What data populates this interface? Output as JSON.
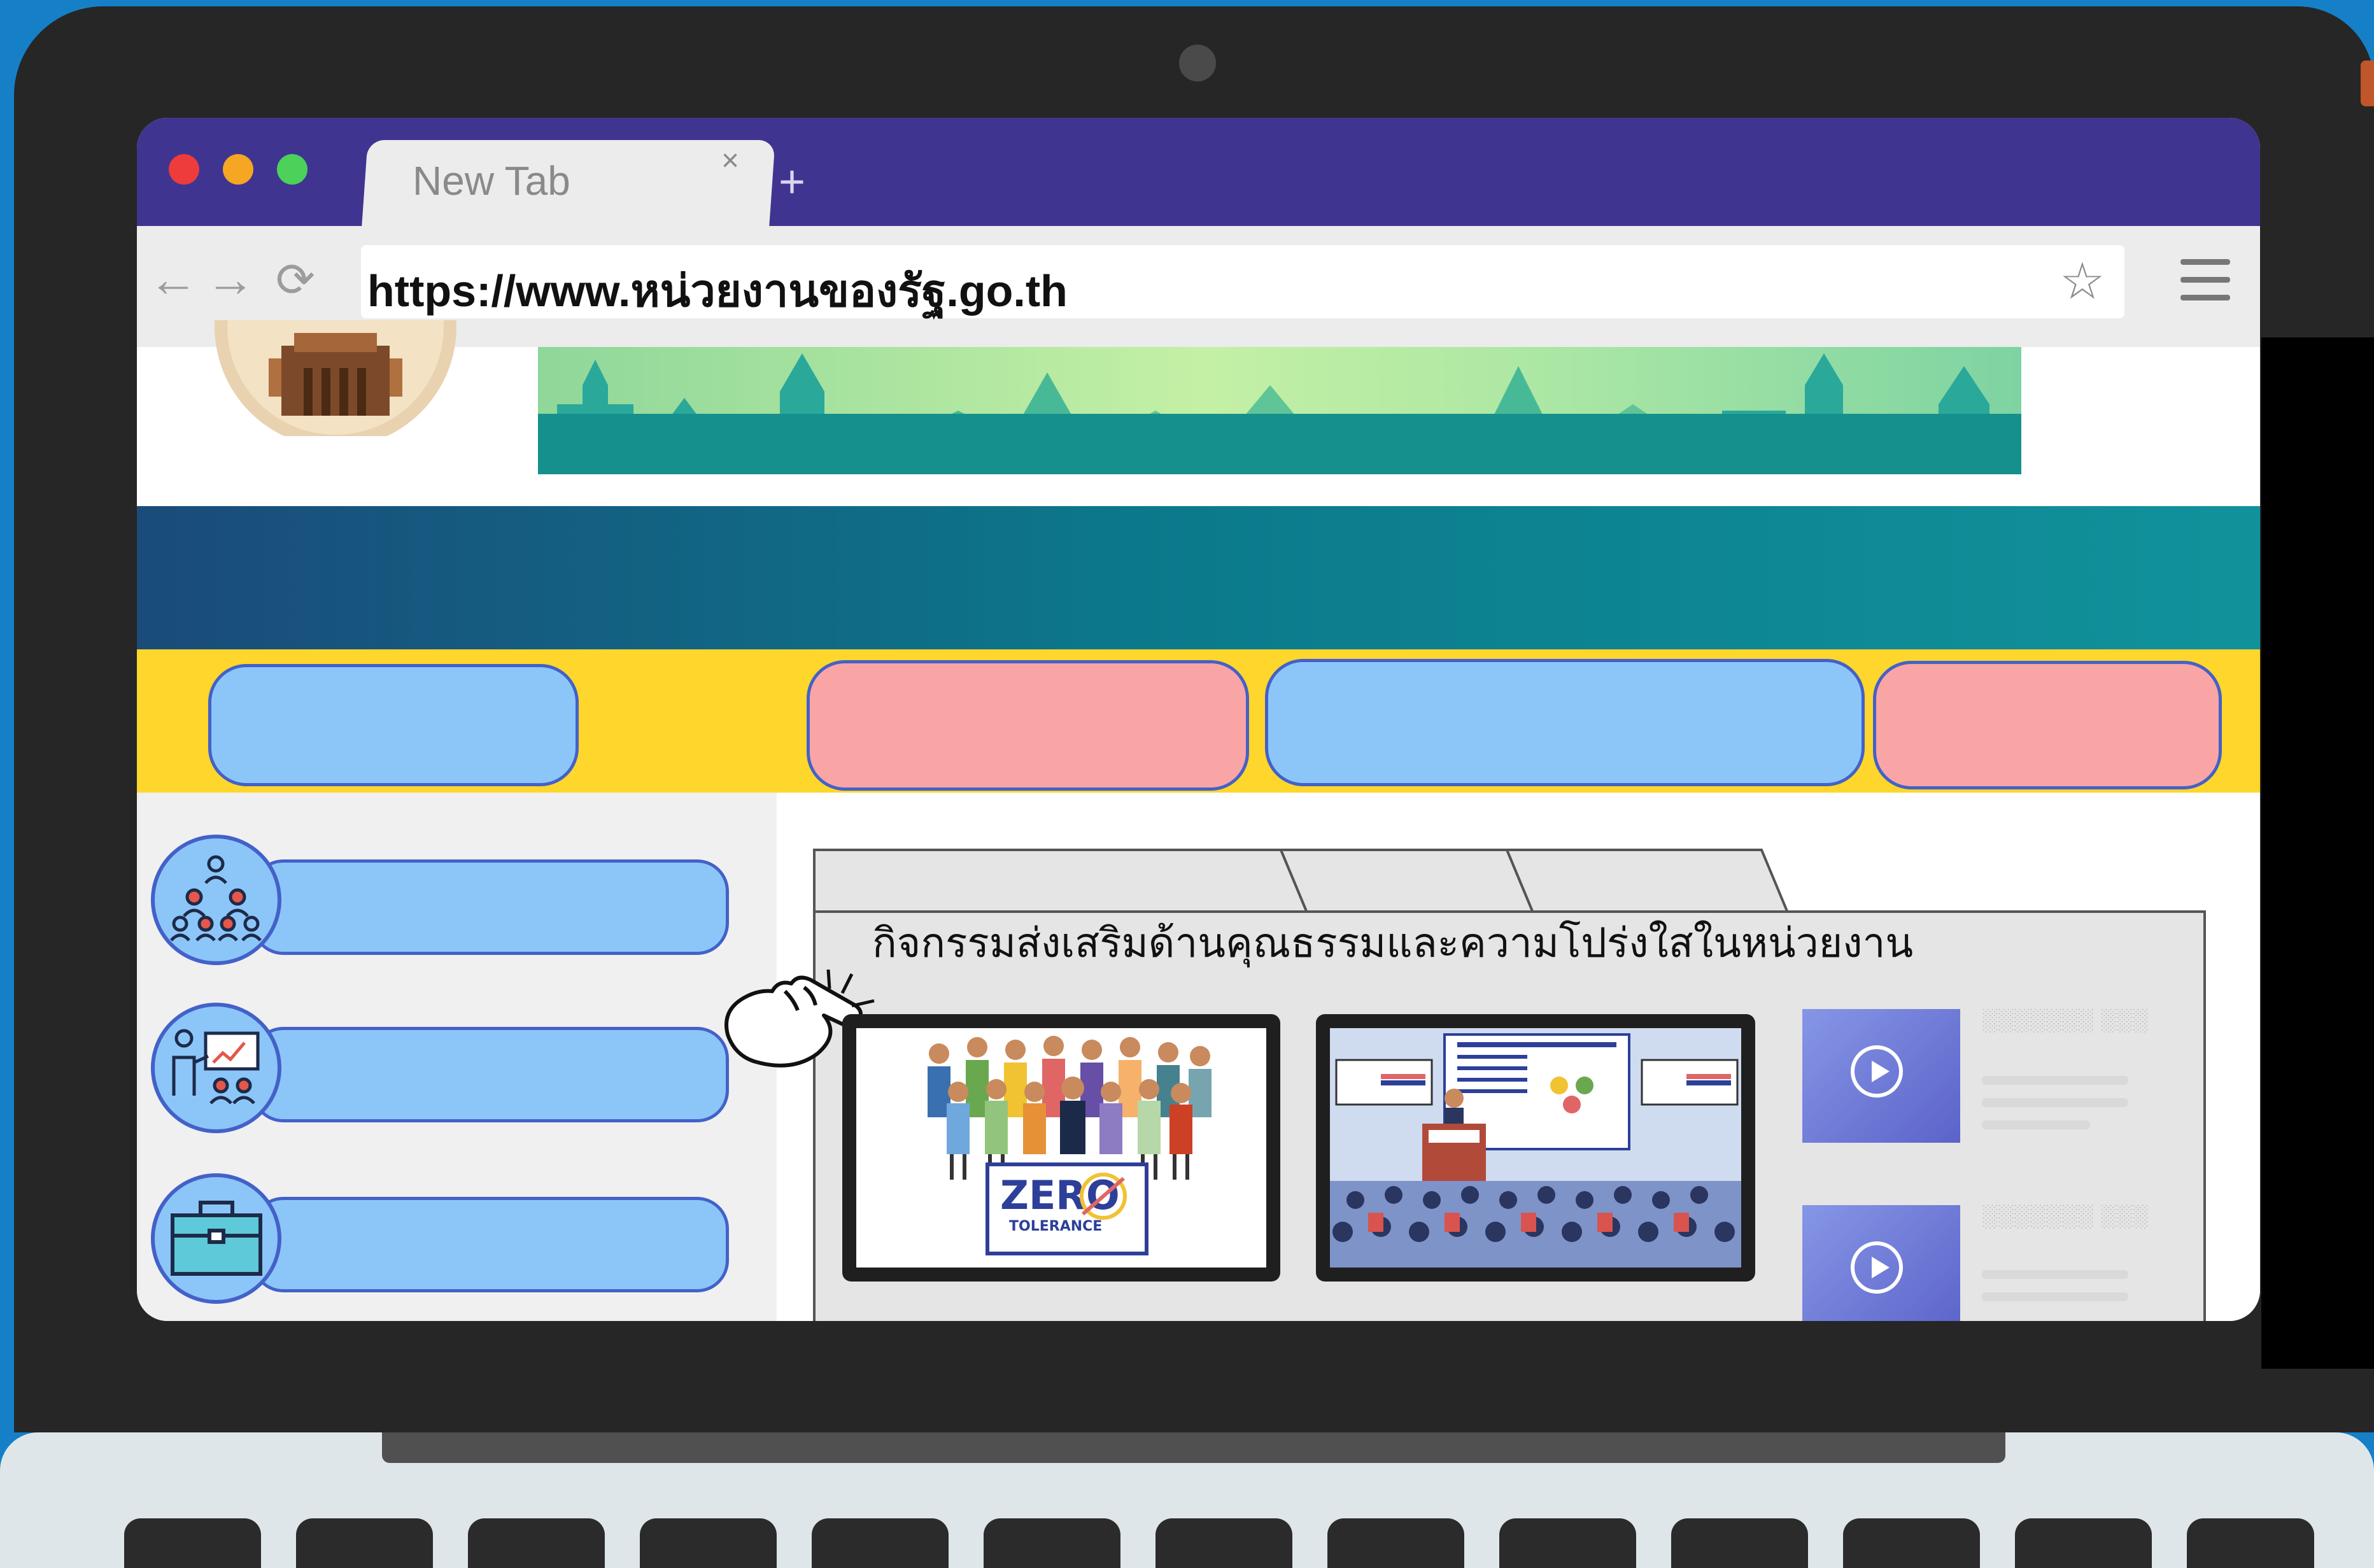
{
  "browser": {
    "tab_title": "New Tab",
    "tab_close": "×",
    "new_tab": "+",
    "back": "←",
    "forward": "→",
    "reload": "⟳",
    "url": "https://www.หน่วยงานของรัฐ.go.th",
    "bookmark_star": "☆"
  },
  "icons": {
    "close_light": "red-light",
    "minimize_light": "yellow-light",
    "maximize_light": "green-light",
    "menu": "hamburger-menu-icon"
  },
  "section": {
    "title": "กิจกรรมส่งเสริมด้านคุณธรรมและความโปร่งใสในหน่วยงาน"
  },
  "thumbnails": {
    "zero_tolerance": {
      "title": "ZERO",
      "subtitle": "TOLERANCE"
    }
  },
  "videos": [
    {
      "label": "░░░░░░░ ░░░"
    },
    {
      "label": "░░░░░░░ ░░░"
    }
  ],
  "colors": {
    "tabbar": "#3f3590",
    "nav_stripe": "#0b7b8c",
    "menu_band": "#ffd62c",
    "pill_blue": "#8cc6f8",
    "pill_pink": "#f9a5a5"
  }
}
